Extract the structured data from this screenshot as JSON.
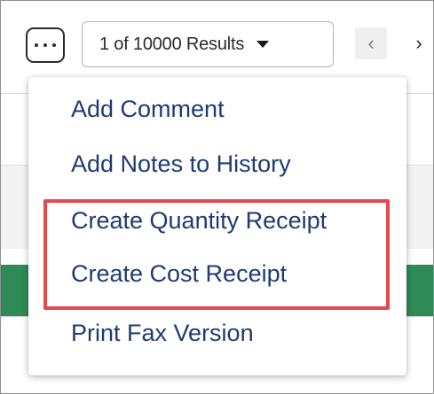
{
  "toolbar": {
    "more_icon": "more-horizontal-icon",
    "results_label": "1 of 10000 Results",
    "caret_icon": "caret-down-icon",
    "prev_glyph": "‹",
    "next_glyph": "›"
  },
  "menu": {
    "items": [
      {
        "label": "Add Comment"
      },
      {
        "label": "Add Notes to History"
      },
      {
        "label": "Create Quantity Receipt"
      },
      {
        "label": "Create Cost Receipt"
      },
      {
        "label": "Print Fax Version"
      }
    ]
  },
  "colors": {
    "menu_text": "#1f3b73",
    "highlight": "#e5484d",
    "green_bar": "#2e8a57"
  }
}
